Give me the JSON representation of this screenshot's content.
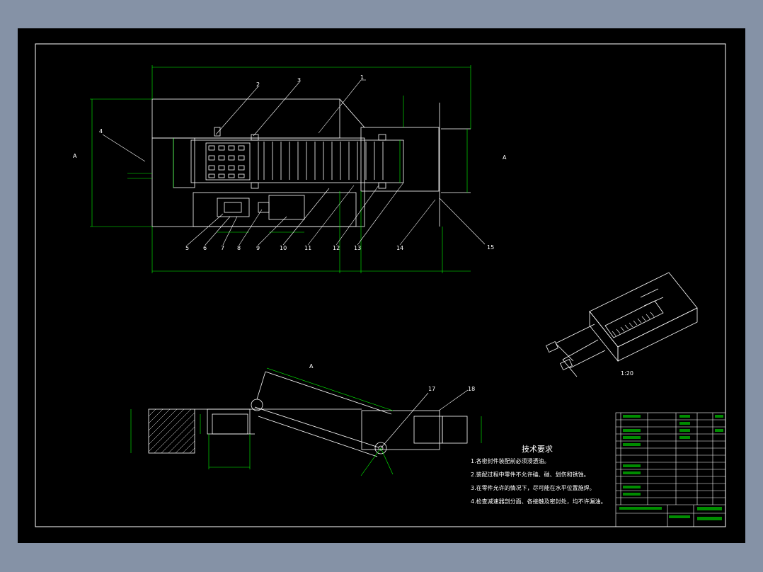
{
  "colors": {
    "background": "#8592a6",
    "canvas": "#000000",
    "geometry": "#ffffff",
    "dimension": "#00ff00",
    "frame": "#ffffff"
  },
  "top_view": {
    "leaders": [
      "1",
      "2",
      "3",
      "4",
      "5",
      "6",
      "7",
      "8",
      "9",
      "10",
      "11",
      "12",
      "13",
      "14",
      "15"
    ],
    "section_mark_left": "A",
    "section_mark_right": "A"
  },
  "side_view": {
    "section_label": "A",
    "leaders": [
      "17",
      "18"
    ]
  },
  "iso_view": {
    "scale_label": "1:20"
  },
  "tech_requirements": {
    "title": "技术要求",
    "items": [
      "1.各密封件装配前必须浸透油。",
      "2.装配过程中零件不允许磕、碰、划伤和锈蚀。",
      "3.在零件允许的情况下，尽可能在水平位置施焊。",
      "4.检查减速器剖分面、各接触及密封处，均不许漏油。"
    ]
  }
}
